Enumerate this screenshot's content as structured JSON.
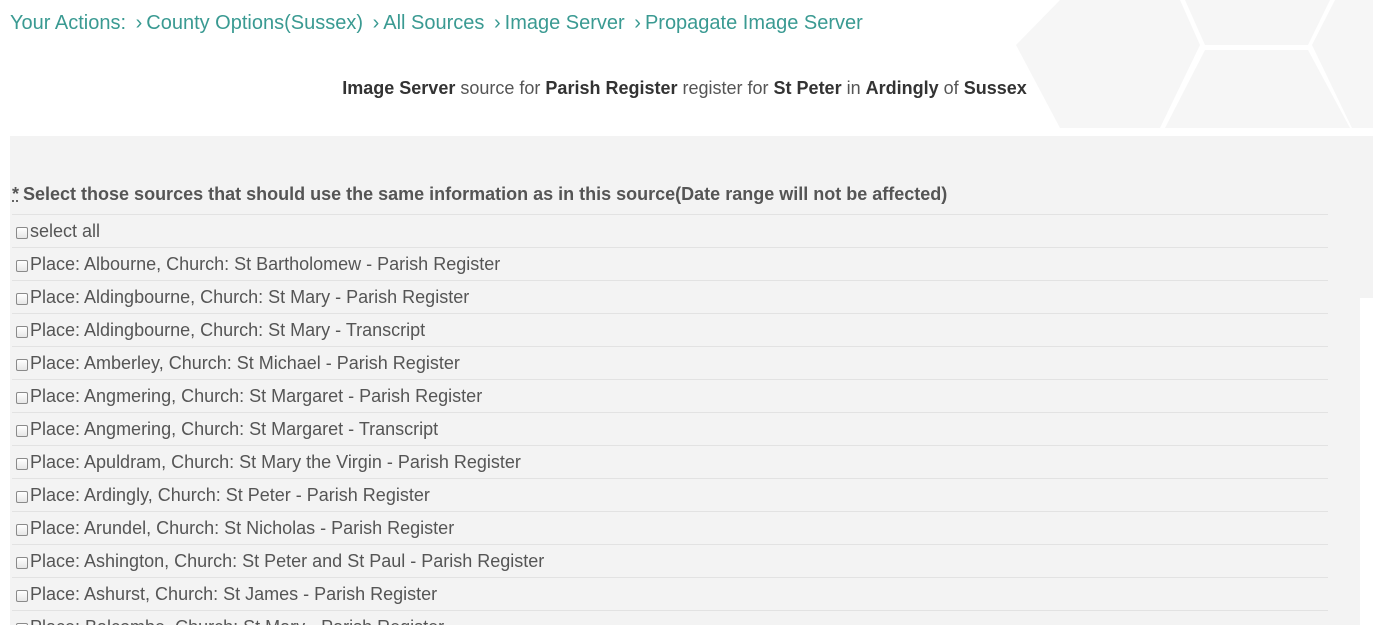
{
  "breadcrumb": {
    "prefix": "Your Actions:",
    "separator": "›",
    "items": [
      "County Options(Sussex)",
      "All Sources",
      "Image Server",
      "Propagate Image Server"
    ]
  },
  "subtitle": {
    "source": "Image Server",
    "t1": "source for",
    "register": "Parish Register",
    "t2": "register for",
    "church": "St Peter",
    "t3": "in",
    "place": "Ardingly",
    "t4": "of",
    "county": "Sussex"
  },
  "form": {
    "required_mark": "*",
    "label": "Select those sources that should use the same information as in this source(Date range will not be affected)",
    "select_all": "select all",
    "options": [
      "Place: Albourne, Church: St Bartholomew - Parish Register",
      "Place: Aldingbourne, Church: St Mary - Parish Register",
      "Place: Aldingbourne, Church: St Mary - Transcript",
      "Place: Amberley, Church: St Michael - Parish Register",
      "Place: Angmering, Church: St Margaret - Parish Register",
      "Place: Angmering, Church: St Margaret - Transcript",
      "Place: Apuldram, Church: St Mary the Virgin - Parish Register",
      "Place: Ardingly, Church: St Peter - Parish Register",
      "Place: Arundel, Church: St Nicholas - Parish Register",
      "Place: Ashington, Church: St Peter and St Paul - Parish Register",
      "Place: Ashurst, Church: St James - Parish Register",
      "Place: Balcombe, Church: St Mary - Parish Register"
    ]
  },
  "colors": {
    "link": "#3a9a92",
    "panel": "#f3f3f3",
    "text": "#555555"
  }
}
